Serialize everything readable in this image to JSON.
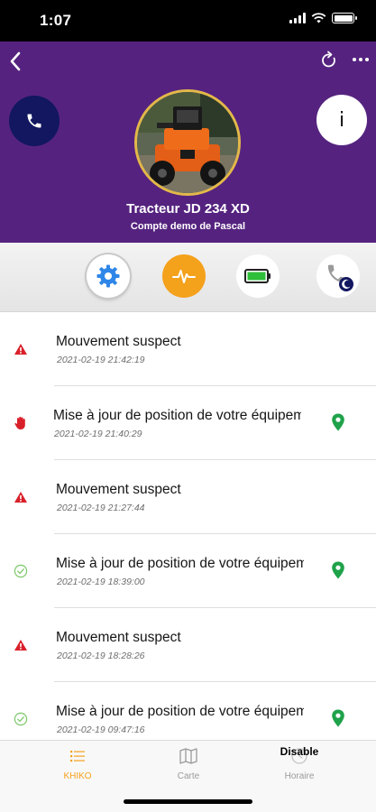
{
  "status_bar": {
    "time": "1:07"
  },
  "header": {
    "title": "Tracteur JD 234 XD",
    "subtitle": "Compte demo de Pascal",
    "info_label": "i",
    "background_color": "#55237f"
  },
  "actions": [
    {
      "icon": "gear-icon"
    },
    {
      "icon": "activity-icon"
    },
    {
      "icon": "battery-icon"
    },
    {
      "icon": "phone-night-icon"
    }
  ],
  "events": [
    {
      "title": "Mouvement suspect",
      "timestamp": "2021-02-19 21:42:19",
      "status_icon": "warning-icon",
      "has_location": false
    },
    {
      "title": "Mise à jour de position de votre équipement",
      "timestamp": "2021-02-19 21:40:29",
      "status_icon": "hand-icon",
      "has_location": true
    },
    {
      "title": "Mouvement suspect",
      "timestamp": "2021-02-19 21:27:44",
      "status_icon": "warning-icon",
      "has_location": false
    },
    {
      "title": "Mise à jour de position de votre équipement",
      "timestamp": "2021-02-19 18:39:00",
      "status_icon": "check-icon",
      "has_location": true
    },
    {
      "title": "Mouvement suspect",
      "timestamp": "2021-02-19 18:28:26",
      "status_icon": "warning-icon",
      "has_location": false
    },
    {
      "title": "Mise à jour de position de votre équipement",
      "timestamp": "2021-02-19 09:47:16",
      "status_icon": "check-icon",
      "has_location": true
    }
  ],
  "tabs": [
    {
      "label": "KHIKO",
      "icon": "list-icon",
      "active": true
    },
    {
      "label": "Carte",
      "icon": "map-icon",
      "active": false
    },
    {
      "label": "Horaire",
      "icon": "clock-icon",
      "active": false,
      "overlay_text": "Disable"
    }
  ],
  "colors": {
    "accent": "#f4a11c",
    "warning": "#d9202a",
    "success": "#7cc86a",
    "location": "#1fa24a",
    "call_button": "#12175f"
  }
}
